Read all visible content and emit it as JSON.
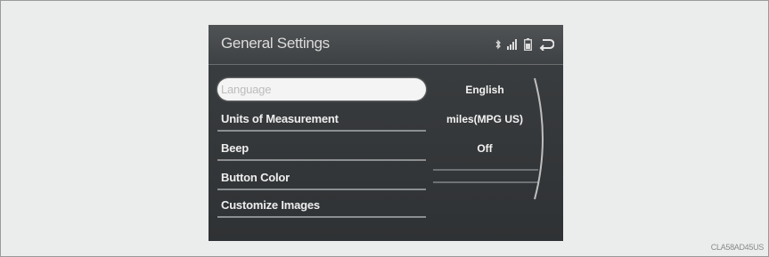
{
  "screen": {
    "title": "General Settings",
    "status_icons": [
      "bluetooth-icon",
      "signal-strength-icon",
      "battery-icon",
      "back-icon"
    ]
  },
  "menu": {
    "items": [
      {
        "label": "Language",
        "value": "English",
        "selected": true
      },
      {
        "label": "Units of Measurement",
        "value": "miles(MPG US)",
        "selected": false
      },
      {
        "label": "Beep",
        "value": "Off",
        "selected": false
      },
      {
        "label": "Button Color",
        "value": "",
        "selected": false
      },
      {
        "label": "Customize Images",
        "value": "",
        "selected": false
      }
    ]
  },
  "figure": {
    "ref_code": "CLA58AD45US"
  },
  "colors": {
    "page_bg": "#e9eaea",
    "screen_bg": "#3a3d3f",
    "selected_bg": "#f4f4f4",
    "text": "#eeeeee"
  }
}
